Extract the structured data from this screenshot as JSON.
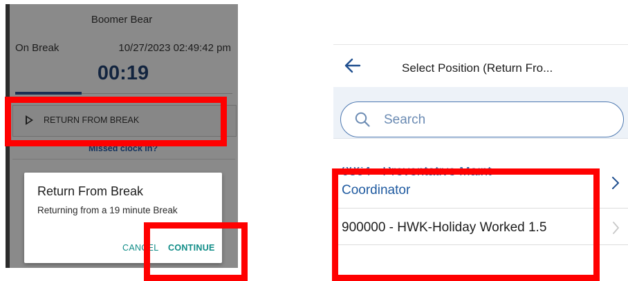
{
  "left_screen": {
    "employee_name": "Boomer Bear",
    "status": "On Break",
    "datetime": "10/27/2023 02:49:42 pm",
    "timer": "00:19",
    "return_button_label": "RETURN FROM BREAK",
    "missed_link": "Missed clock in?",
    "dialog": {
      "title": "Return From Break",
      "message": "Returning from a 19 minute Break",
      "cancel_label": "CANCEL",
      "continue_label": "CONTINUE"
    }
  },
  "right_screen": {
    "header_title": "Select Position (Return Fro...",
    "search_placeholder": "Search",
    "positions": [
      {
        "line1": "0864 - Preventative Maint",
        "line2": "Coordinator"
      },
      {
        "line1": "900000 - HWK-Holiday Worked 1.5"
      }
    ]
  },
  "colors": {
    "highlight_red": "#ff0000",
    "accent_teal": "#0f8c87",
    "link_blue": "#1f5aa0",
    "timer_navy": "#12243f"
  },
  "icons": [
    "play-icon",
    "back-arrow-icon",
    "search-icon",
    "chevron-right-icon"
  ]
}
